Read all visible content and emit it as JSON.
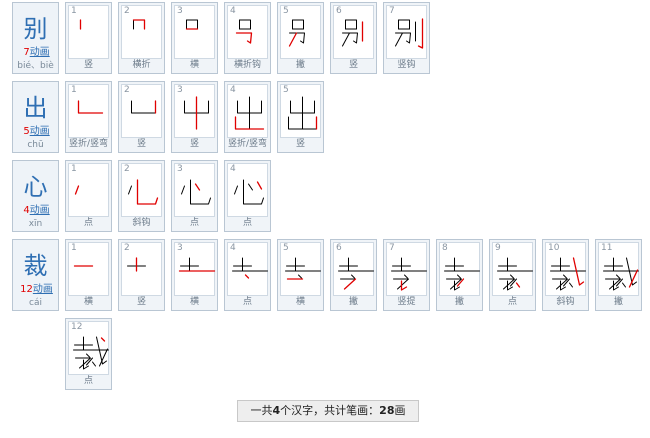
{
  "characters": [
    {
      "char": "别",
      "stroke_count": "7",
      "animate_label": "动画",
      "pinyin": "bié、biè",
      "strokes": [
        {
          "num": "1",
          "name": "竖"
        },
        {
          "num": "2",
          "name": "横折"
        },
        {
          "num": "3",
          "name": "横"
        },
        {
          "num": "4",
          "name": "横折钩"
        },
        {
          "num": "5",
          "name": "撇"
        },
        {
          "num": "6",
          "name": "竖"
        },
        {
          "num": "7",
          "name": "竖钩"
        }
      ]
    },
    {
      "char": "出",
      "stroke_count": "5",
      "animate_label": "动画",
      "pinyin": "chū",
      "strokes": [
        {
          "num": "1",
          "name": "竖折/竖弯"
        },
        {
          "num": "2",
          "name": "竖"
        },
        {
          "num": "3",
          "name": "竖"
        },
        {
          "num": "4",
          "name": "竖折/竖弯"
        },
        {
          "num": "5",
          "name": "竖"
        }
      ]
    },
    {
      "char": "心",
      "stroke_count": "4",
      "animate_label": "动画",
      "pinyin": "xīn",
      "strokes": [
        {
          "num": "1",
          "name": "点"
        },
        {
          "num": "2",
          "name": "斜钩"
        },
        {
          "num": "3",
          "name": "点"
        },
        {
          "num": "4",
          "name": "点"
        }
      ]
    },
    {
      "char": "裁",
      "stroke_count": "12",
      "animate_label": "动画",
      "pinyin": "cái",
      "strokes": [
        {
          "num": "1",
          "name": "横"
        },
        {
          "num": "2",
          "name": "竖"
        },
        {
          "num": "3",
          "name": "横"
        },
        {
          "num": "4",
          "name": "点"
        },
        {
          "num": "5",
          "name": "横"
        },
        {
          "num": "6",
          "name": "撇"
        },
        {
          "num": "7",
          "name": "竖提"
        },
        {
          "num": "8",
          "name": "撇"
        },
        {
          "num": "9",
          "name": "点"
        },
        {
          "num": "10",
          "name": "斜钩"
        },
        {
          "num": "11",
          "name": "撇"
        },
        {
          "num": "12",
          "name": "点"
        }
      ]
    }
  ],
  "footer": {
    "prefix": "一共",
    "char_total": "4",
    "mid": "个汉字，共计笔画：",
    "stroke_total": "28",
    "suffix": "画"
  },
  "colors": {
    "header_char": "#2f6fb3",
    "new_stroke": "#e00000",
    "done_stroke": "#000000",
    "cell_border": "#b9c6d3"
  }
}
